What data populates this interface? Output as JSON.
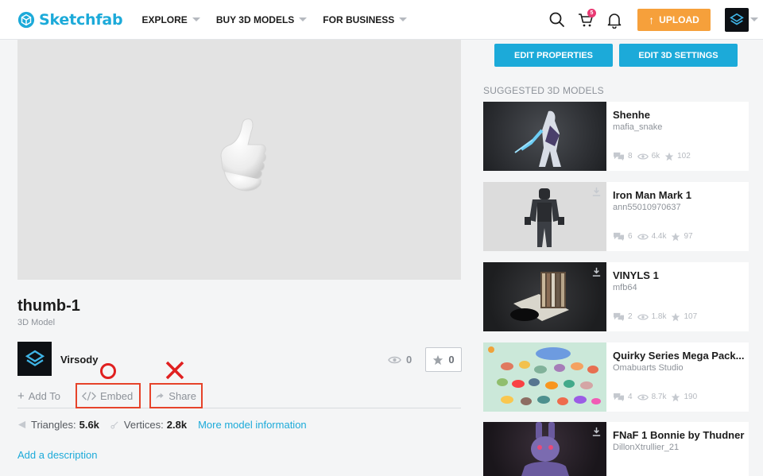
{
  "header": {
    "logo_text": "Sketchfab",
    "nav": [
      {
        "label": "EXPLORE"
      },
      {
        "label": "BUY 3D MODELS"
      },
      {
        "label": "FOR BUSINESS"
      }
    ],
    "cart_count": "5",
    "upload_label": "UPLOAD"
  },
  "model": {
    "title": "thumb-1",
    "subtitle": "3D Model",
    "author": "Virsody",
    "views": "0",
    "likes": "0",
    "actions": {
      "add_to": "Add To",
      "embed": "Embed",
      "share": "Share"
    },
    "triangles_label": "Triangles:",
    "triangles": "5.6k",
    "vertices_label": "Vertices:",
    "vertices": "2.8k",
    "more_info": "More model information",
    "add_description": "Add a description"
  },
  "right": {
    "edit_properties": "EDIT PROPERTIES",
    "edit_3d_settings": "EDIT 3D SETTINGS",
    "suggested_title": "SUGGESTED 3D MODELS",
    "suggested": [
      {
        "name": "Shenhe",
        "author": "mafia_snake",
        "comments": "8",
        "views": "6k",
        "likes": "102"
      },
      {
        "name": "Iron Man Mark 1",
        "author": "ann55010970637",
        "comments": "6",
        "views": "4.4k",
        "likes": "97"
      },
      {
        "name": "VINYLS 1",
        "author": "mfb64",
        "comments": "2",
        "views": "1.8k",
        "likes": "107"
      },
      {
        "name": "Quirky Series Mega Pack...",
        "author": "Omabuarts Studio",
        "comments": "4",
        "views": "8.7k",
        "likes": "190"
      },
      {
        "name": "FNaF 1 Bonnie by Thudner",
        "author": "DillonXtrullier_21",
        "comments": "",
        "views": "",
        "likes": ""
      }
    ]
  },
  "colors": {
    "brand": "#1caad9",
    "upload": "#f6a03b",
    "annotation_red": "#e02020"
  },
  "icons": [
    "search-icon",
    "cart-icon",
    "bell-icon",
    "eye-icon",
    "star-icon",
    "comment-icon",
    "code-icon",
    "share-arrow-icon",
    "download-icon"
  ]
}
